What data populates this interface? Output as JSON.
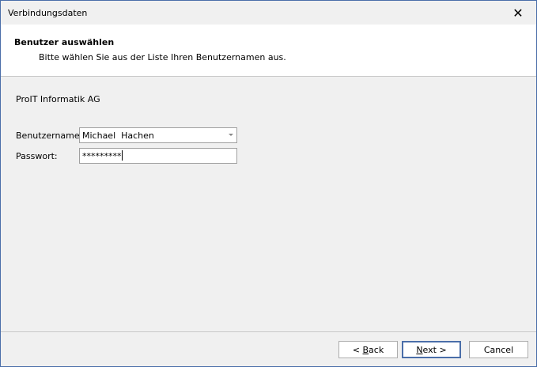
{
  "window": {
    "title": "Verbindungsdaten",
    "close_icon": "close-icon"
  },
  "header": {
    "title": "Benutzer auswählen",
    "subtitle": "Bitte wählen Sie aus der Liste Ihren Benutzernamen aus."
  },
  "company": "ProIT Informatik AG",
  "form": {
    "username_label": "Benutzername:",
    "username_value": "Michael  Hachen",
    "password_label": "Passwort:",
    "password_value": "*********"
  },
  "buttons": {
    "back_prefix": "< ",
    "back_mnemonic": "B",
    "back_rest": "ack",
    "next_mnemonic": "N",
    "next_rest": "ext >",
    "cancel": "Cancel"
  }
}
